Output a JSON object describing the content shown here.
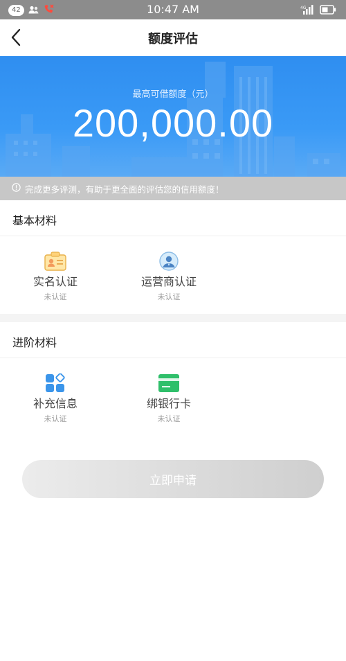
{
  "status_bar": {
    "notification_count": "42",
    "time": "10:47 AM",
    "network": "4G"
  },
  "nav": {
    "title": "额度评估",
    "back_icon": "chevron-left-icon"
  },
  "hero": {
    "label": "最高可借额度（元）",
    "amount": "200,000.00",
    "bg_color": "#3a9af6"
  },
  "notice": {
    "text": "完成更多评测，有助于更全面的评估您的信用额度！",
    "icon": "info-icon"
  },
  "basic": {
    "title": "基本材料",
    "items": [
      {
        "label": "实名认证",
        "status": "未认证",
        "icon": "id-card-icon"
      },
      {
        "label": "运营商认证",
        "status": "未认证",
        "icon": "carrier-avatar-icon"
      }
    ]
  },
  "advanced": {
    "title": "进阶材料",
    "items": [
      {
        "label": "补充信息",
        "status": "未认证",
        "icon": "apps-grid-icon"
      },
      {
        "label": "绑银行卡",
        "status": "未认证",
        "icon": "bank-card-icon"
      }
    ]
  },
  "apply_button": {
    "label": "立即申请"
  }
}
